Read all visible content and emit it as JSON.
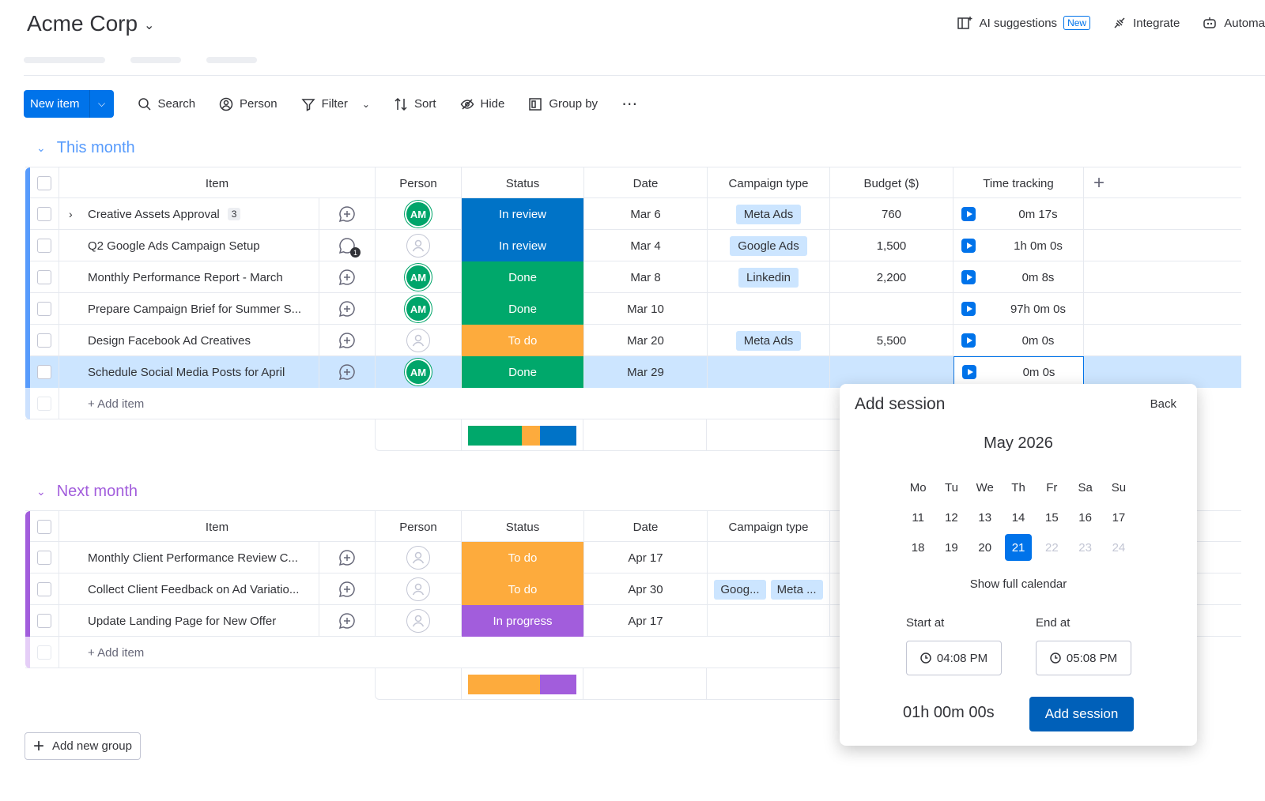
{
  "header": {
    "board_title": "Acme Corp",
    "ai_suggestions": "AI suggestions",
    "new_badge": "New",
    "integrate": "Integrate",
    "automate": "Automa"
  },
  "toolbar": {
    "new_item": "New item",
    "search": "Search",
    "person": "Person",
    "filter": "Filter",
    "sort": "Sort",
    "hide": "Hide",
    "group_by": "Group by"
  },
  "columns": {
    "item": "Item",
    "person": "Person",
    "status": "Status",
    "date": "Date",
    "campaign_type": "Campaign type",
    "budget": "Budget ($)",
    "time_tracking": "Time tracking"
  },
  "groups": [
    {
      "title": "This month",
      "color": "#579bfc",
      "add_item": "+ Add item",
      "rows": [
        {
          "item": "Creative Assets Approval",
          "subitems": "3",
          "person": "AM",
          "status": "In review",
          "status_color": "#0073c7",
          "date": "Mar 6",
          "campaign": [
            "Meta Ads"
          ],
          "budget": "760",
          "time": "0m 17s",
          "updates": ""
        },
        {
          "item": "Q2 Google Ads Campaign Setup",
          "subitems": "",
          "person": "",
          "status": "In review",
          "status_color": "#0073c7",
          "date": "Mar 4",
          "campaign": [
            "Google Ads"
          ],
          "budget": "1,500",
          "time": "1h 0m 0s",
          "updates": "1"
        },
        {
          "item": "Monthly Performance Report - March",
          "subitems": "",
          "person": "AM",
          "status": "Done",
          "status_color": "#00a86b",
          "date": "Mar 8",
          "campaign": [
            "Linkedin"
          ],
          "budget": "2,200",
          "time": "0m 8s",
          "updates": ""
        },
        {
          "item": "Prepare Campaign Brief for Summer S...",
          "subitems": "",
          "person": "AM",
          "status": "Done",
          "status_color": "#00a86b",
          "date": "Mar 10",
          "campaign": [],
          "budget": "",
          "time": "97h 0m 0s",
          "updates": ""
        },
        {
          "item": "Design Facebook Ad Creatives",
          "subitems": "",
          "person": "",
          "status": "To do",
          "status_color": "#fdab3d",
          "date": "Mar 20",
          "campaign": [
            "Meta Ads"
          ],
          "budget": "5,500",
          "time": "0m 0s",
          "updates": ""
        },
        {
          "item": "Schedule Social Media Posts for April",
          "subitems": "",
          "person": "AM",
          "status": "Done",
          "status_color": "#00a86b",
          "date": "Mar 29",
          "campaign": [],
          "budget": "",
          "time": "0m 0s",
          "updates": ""
        }
      ],
      "summary": [
        {
          "color": "#00a86b",
          "fraction": 0.5
        },
        {
          "color": "#fdab3d",
          "fraction": 0.1667
        },
        {
          "color": "#0073c7",
          "fraction": 0.3333
        }
      ]
    },
    {
      "title": "Next month",
      "color": "#a25ddc",
      "add_item": "+ Add item",
      "rows": [
        {
          "item": "Monthly Client Performance Review C...",
          "person": "",
          "status": "To do",
          "status_color": "#fdab3d",
          "date": "Apr 17",
          "campaign": []
        },
        {
          "item": "Collect Client Feedback on Ad Variatio...",
          "person": "",
          "status": "To do",
          "status_color": "#fdab3d",
          "date": "Apr 30",
          "campaign": [
            "Goog...",
            "Meta ..."
          ]
        },
        {
          "item": "Update Landing Page for New Offer",
          "person": "",
          "status": "In progress",
          "status_color": "#a25ddc",
          "date": "Apr 17",
          "campaign": []
        }
      ],
      "summary": [
        {
          "color": "#fdab3d",
          "fraction": 0.6667
        },
        {
          "color": "#a25ddc",
          "fraction": 0.3333
        }
      ]
    }
  ],
  "add_new_group": "Add new group",
  "popover": {
    "title": "Add session",
    "back": "Back",
    "month": "May 2026",
    "weekdays": [
      "Mo",
      "Tu",
      "We",
      "Th",
      "Fr",
      "Sa",
      "Su"
    ],
    "week1": [
      "11",
      "12",
      "13",
      "14",
      "15",
      "16",
      "17"
    ],
    "week2": [
      "18",
      "19",
      "20",
      "21",
      "22",
      "23",
      "24"
    ],
    "selected_day": "21",
    "show_full_calendar": "Show full calendar",
    "start_label": "Start at",
    "end_label": "End at",
    "start_time": "04:08 PM",
    "end_time": "05:08 PM",
    "duration": "01h 00m 00s",
    "add_button": "Add session"
  }
}
